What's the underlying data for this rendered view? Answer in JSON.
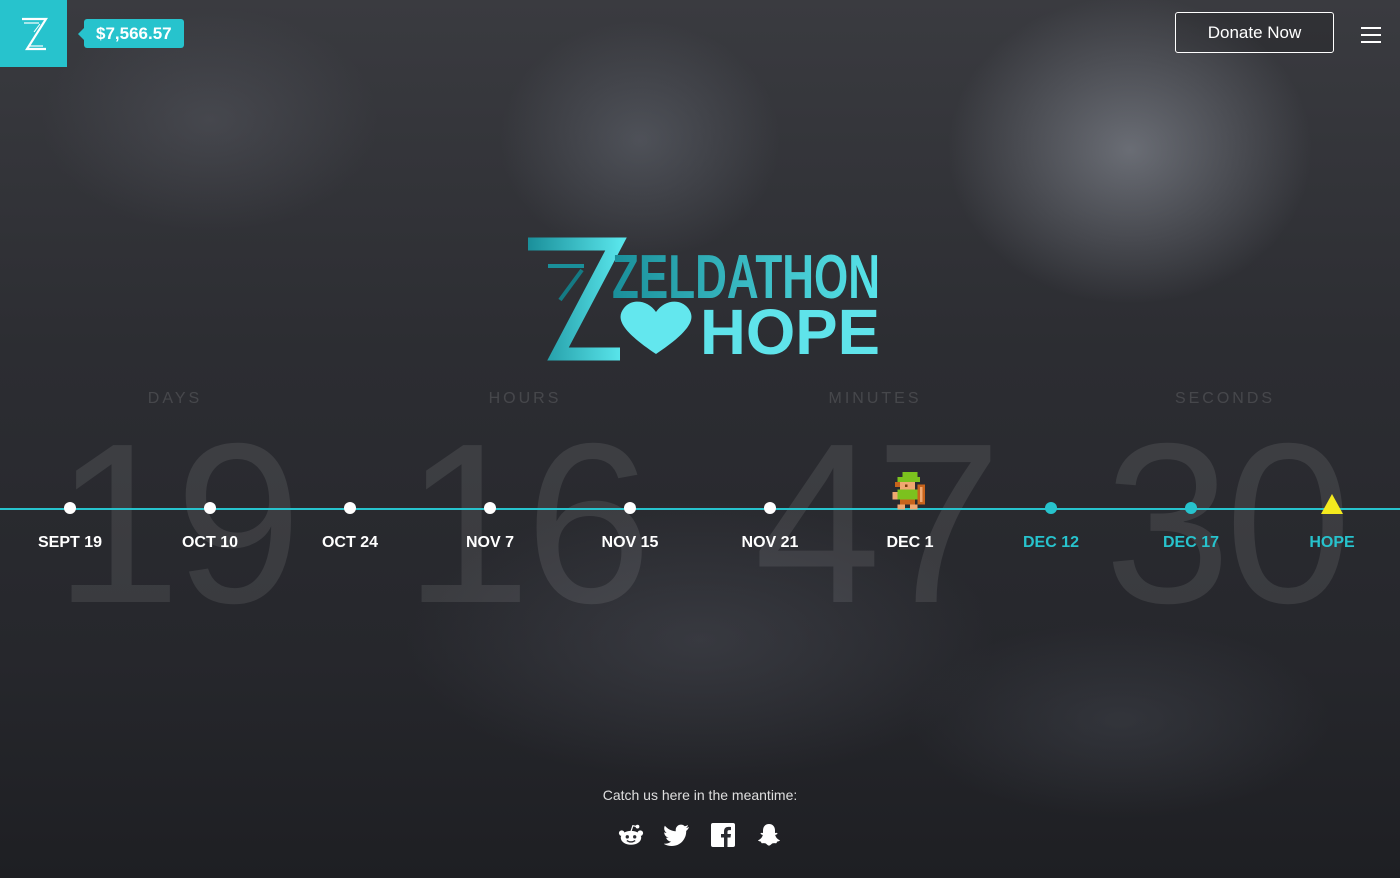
{
  "header": {
    "logo_icon": "zelda-z-icon",
    "donation_total": "$7,566.57",
    "donate_label": "Donate Now",
    "menu_icon": "hamburger-menu-icon"
  },
  "hero": {
    "title_line1": "ZELDATHON",
    "title_line2": "HOPE",
    "accent_color": "#27c3cd"
  },
  "countdown": [
    {
      "label": "DAYS",
      "value": "19"
    },
    {
      "label": "HOURS",
      "value": "16"
    },
    {
      "label": "MINUTES",
      "value": "47"
    },
    {
      "label": "SECONDS",
      "value": "30"
    }
  ],
  "timeline": {
    "items": [
      {
        "label": "SEPT 19",
        "state": "past"
      },
      {
        "label": "OCT 10",
        "state": "past"
      },
      {
        "label": "OCT 24",
        "state": "past"
      },
      {
        "label": "NOV 7",
        "state": "past"
      },
      {
        "label": "NOV 15",
        "state": "past"
      },
      {
        "label": "NOV 21",
        "state": "past"
      },
      {
        "label": "DEC 1",
        "state": "current"
      },
      {
        "label": "DEC 12",
        "state": "future"
      },
      {
        "label": "DEC 17",
        "state": "future"
      },
      {
        "label": "HOPE",
        "state": "goal"
      }
    ],
    "current_marker_icon": "link-sprite-icon",
    "goal_icon": "triforce-icon"
  },
  "footer": {
    "catch_text": "Catch us here in the meantime:",
    "socials": [
      {
        "name": "reddit",
        "icon": "reddit-icon"
      },
      {
        "name": "twitter",
        "icon": "twitter-icon"
      },
      {
        "name": "facebook",
        "icon": "facebook-icon"
      },
      {
        "name": "snapchat",
        "icon": "snapchat-icon"
      }
    ]
  }
}
